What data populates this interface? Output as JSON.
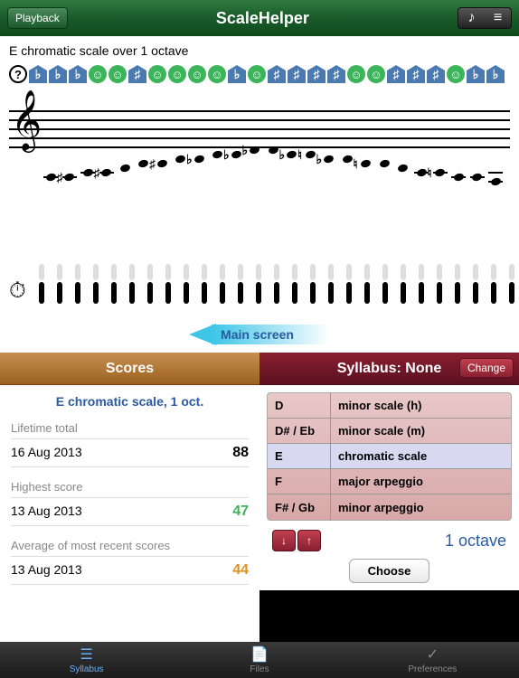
{
  "header": {
    "playback": "Playback",
    "title": "ScaleHelper"
  },
  "scale": {
    "title": "E chromatic scale over 1 octave",
    "feedback": [
      "?",
      "♭",
      "♭",
      "♭",
      "☺",
      "☺",
      "♯",
      "☺",
      "☺",
      "☺",
      "☺",
      "♭",
      "☺",
      "♯",
      "♯",
      "♯",
      "♯",
      "☺",
      "☺",
      "♯",
      "♯",
      "♯",
      "☺",
      "♭",
      "♭"
    ],
    "main_screen": "Main screen"
  },
  "scores": {
    "header": "Scores",
    "subtitle": "E chromatic scale, 1 oct.",
    "lifetime_label": "Lifetime total",
    "lifetime_date": "16 Aug 2013",
    "lifetime_value": "88",
    "highest_label": "Highest score",
    "highest_date": "13 Aug 2013",
    "highest_value": "47",
    "avg_label": "Average of most recent scores",
    "avg_date": "13 Aug 2013",
    "avg_value": "44"
  },
  "syllabus": {
    "header": "Syllabus: None",
    "change": "Change",
    "rows": [
      {
        "key": "D",
        "type": "minor scale (h)"
      },
      {
        "key": "D# / Eb",
        "type": "minor scale (m)"
      },
      {
        "key": "E",
        "type": "chromatic scale"
      },
      {
        "key": "F",
        "type": "major arpeggio"
      },
      {
        "key": "F# / Gb",
        "type": "minor arpeggio"
      }
    ],
    "octave": "1 octave",
    "choose": "Choose"
  },
  "tabs": {
    "syllabus": "Syllabus",
    "files": "Files",
    "preferences": "Preferences"
  }
}
